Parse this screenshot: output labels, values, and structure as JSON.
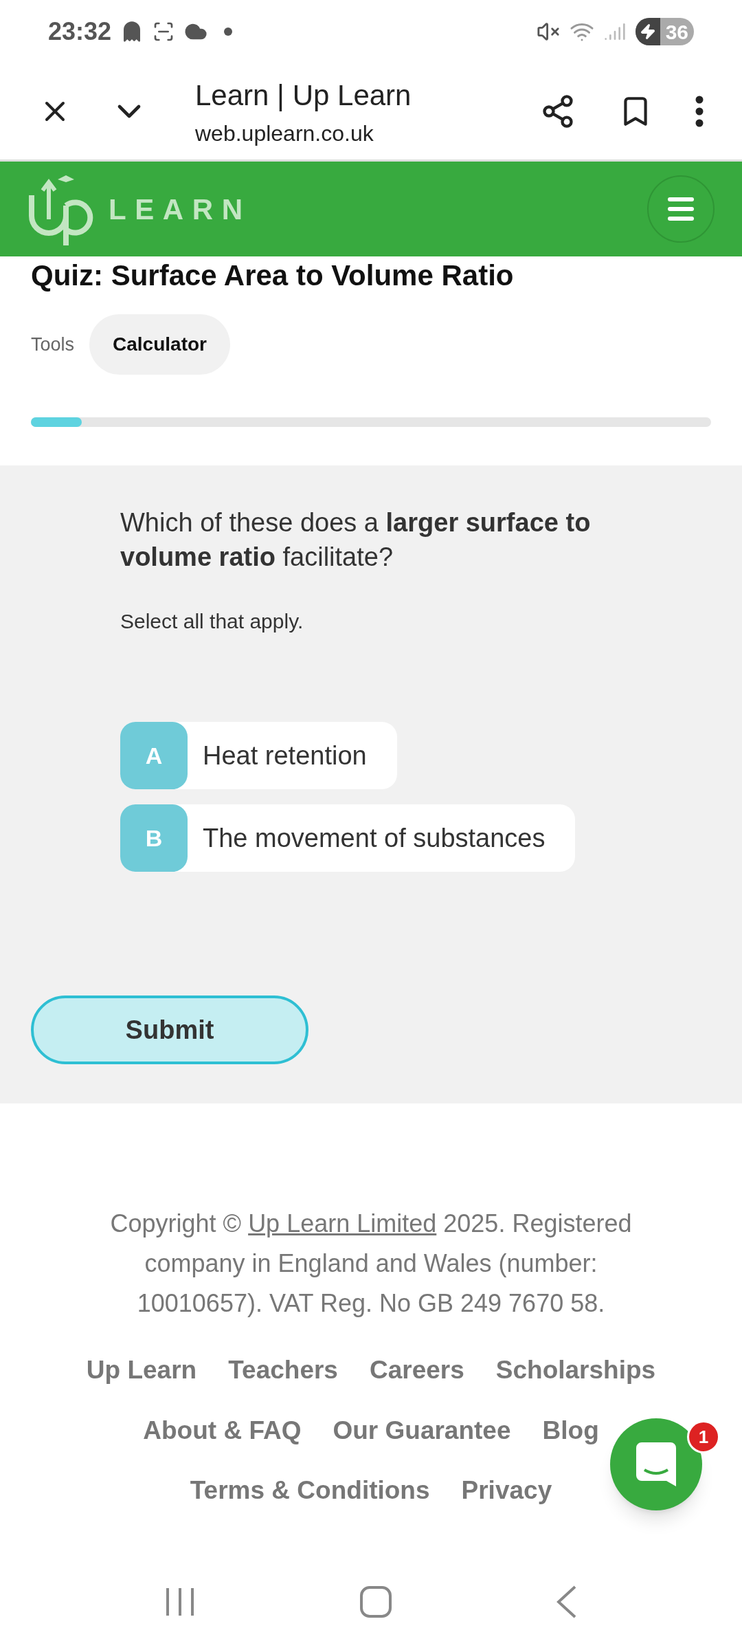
{
  "status_bar": {
    "time": "23:32",
    "battery": "36",
    "charging": true
  },
  "browser": {
    "title": "Learn | Up Learn",
    "url": "web.uplearn.co.uk"
  },
  "header": {
    "logo_word": "LEARN"
  },
  "quiz": {
    "title": "Quiz: Surface Area to Volume Ratio",
    "tools_label": "Tools",
    "tools": [
      {
        "label": "Calculator"
      }
    ],
    "progress": {
      "level": 0.075
    }
  },
  "question": {
    "text": "Which of these does a **larger surface to volume ratio** facilitate?",
    "instruction": "Select all that apply.",
    "options": [
      {
        "letter": "A",
        "text": "Heat retention",
        "selected": false
      },
      {
        "letter": "B",
        "text": "The movement of substances",
        "selected": false
      }
    ],
    "submit": "Submit"
  },
  "footer": {
    "copyright_before": "Copyright ©",
    "copyright_link": "Up Learn Limited",
    "copyright_after": "2025. Registered company in England and Wales (number: 10010657). VAT Reg. No GB 249 7670 58.",
    "link_rows": [
      [
        "Up Learn",
        "Teachers",
        "Careers",
        "Scholarships"
      ],
      [
        "About & FAQ",
        "Our Guarantee",
        "Blog"
      ],
      [
        "Terms & Conditions",
        "Privacy"
      ]
    ]
  },
  "chat": {
    "badge": "1"
  }
}
